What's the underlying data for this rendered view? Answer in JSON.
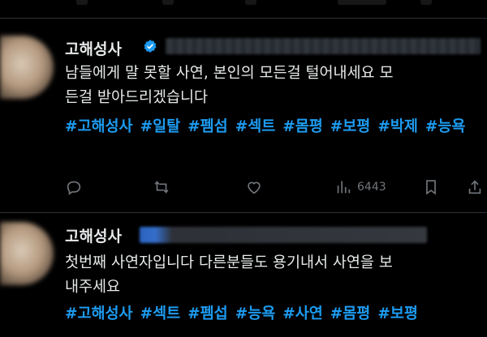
{
  "posts": [
    {
      "author": "고해성사",
      "text_lines": [
        "남들에게 말 못할 사연, 본인의 모든걸 털어내세요 모",
        "든걸 받아드리겠습니다"
      ],
      "hashtags": [
        "#고해성사",
        "#일탈",
        "#펨섬",
        "#섹트",
        "#몸평",
        "#보평",
        "#박제",
        "#능욕"
      ],
      "views": "6443",
      "verified": true
    },
    {
      "author": "고해성사",
      "text_lines": [
        "첫번째 사연자입니다 다른분들도 용기내서 사연을 보",
        "내주세요"
      ],
      "hashtags": [
        "#고해성사",
        "#섹트",
        "#펨섭",
        "#능욕",
        "#사연",
        "#몸평",
        "#보평"
      ]
    }
  ],
  "icons": {
    "reply": "reply-icon",
    "repost": "repost-icon",
    "like": "like-icon",
    "views": "views-icon",
    "bookmark": "bookmark-icon",
    "verified": "verified-badge-icon"
  },
  "colors": {
    "background": "#000000",
    "text": "#e7e9ea",
    "hashtag": "#1d9bf0",
    "muted": "#71767b",
    "verified": "#1d9bf0"
  }
}
